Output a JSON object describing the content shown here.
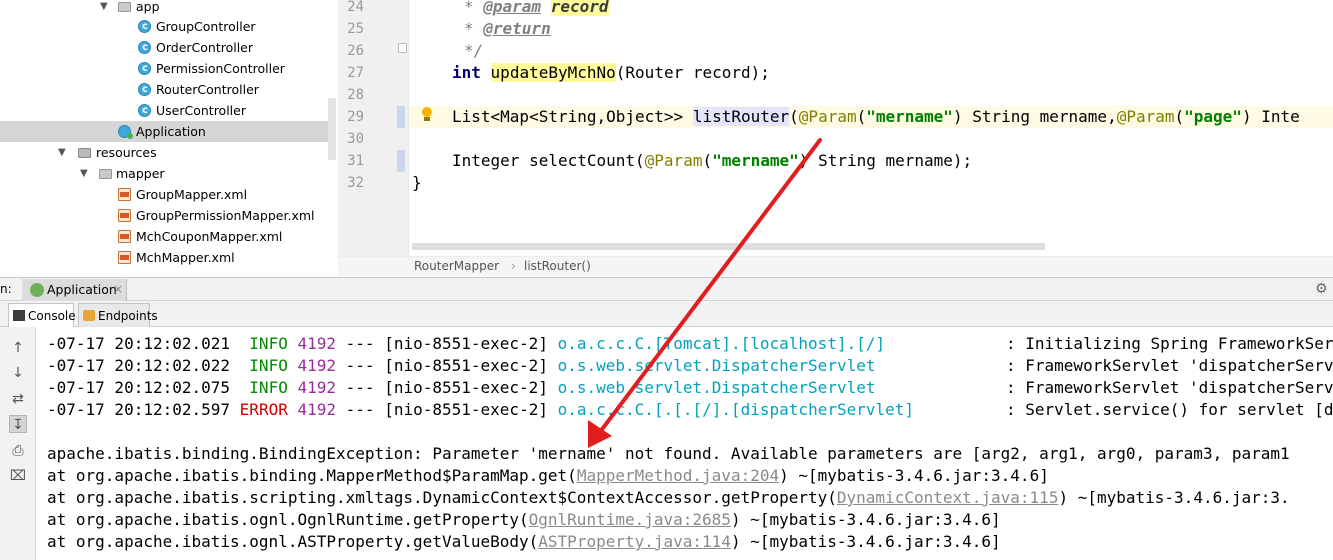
{
  "colors": {
    "arrow": "#e11d1d",
    "selection": "#d5d5d5",
    "info": "#008b00",
    "error": "#d00000",
    "link": "#8a8a8a"
  },
  "tree": {
    "items": [
      {
        "label": "app",
        "kind": "folder"
      },
      {
        "label": "GroupController",
        "kind": "class"
      },
      {
        "label": "OrderController",
        "kind": "class"
      },
      {
        "label": "PermissionController",
        "kind": "class"
      },
      {
        "label": "RouterController",
        "kind": "class"
      },
      {
        "label": "UserController",
        "kind": "class"
      },
      {
        "label": "Application",
        "kind": "app-class",
        "selected": true
      },
      {
        "label": "resources",
        "kind": "folder"
      },
      {
        "label": "mapper",
        "kind": "folder"
      },
      {
        "label": "GroupMapper.xml",
        "kind": "xml"
      },
      {
        "label": "GroupPermissionMapper.xml",
        "kind": "xml"
      },
      {
        "label": "MchCouponMapper.xml",
        "kind": "xml"
      },
      {
        "label": "MchMapper.xml",
        "kind": "xml"
      }
    ]
  },
  "editor": {
    "line_numbers": [
      "24",
      "25",
      "26",
      "27",
      "28",
      "29",
      "30",
      "31",
      "32"
    ],
    "lines": {
      "l24_star": "* ",
      "l24_tag": "@param",
      "l24_sp": " ",
      "l24_name": "record",
      "l25_star": "* ",
      "l25_tag": "@return",
      "l26": "*/",
      "l27_kw": "int",
      "l27_method": "updateByMchNo",
      "l27_rest": "(Router record);",
      "l29_a": "List<Map<String,Object>> ",
      "l29_method": "listRouter",
      "l29_b": "(",
      "l29_ann1": "@Param",
      "l29_c": "(",
      "l29_str1": "\"mername\"",
      "l29_d": ") String mername,",
      "l29_ann2": "@Param",
      "l29_e": "(",
      "l29_str2": "\"page\"",
      "l29_f": ") Inte",
      "l31_a": "Integer selectCount(",
      "l31_ann": "@Param",
      "l31_b": "(",
      "l31_str": "\"mername\"",
      "l31_c": ") String mername);",
      "l32": "}"
    },
    "breadcrumb": [
      "RouterMapper",
      "listRouter()"
    ],
    "breadcrumb_sep": "›"
  },
  "run_panel": {
    "label": "n:",
    "tab_label": "Application",
    "tab_close": "×",
    "settings_glyph": "⚙",
    "subtabs": {
      "console": "Console",
      "endpoints": "Endpoints"
    },
    "toolbar_glyphs": [
      "↑",
      "↓",
      "⇄",
      "↧",
      "⎙",
      "⌧"
    ]
  },
  "console": {
    "logs": [
      {
        "time": "-07-17 20:12:02.021",
        "level": "INFO",
        "pid": "4192",
        "dash": "---",
        "thread": "[nio-8551-exec-2]",
        "logger": "o.a.c.c.C.[Tomcat].[localhost].[/]",
        "msg": ": Initializing Spring FrameworkServ"
      },
      {
        "time": "-07-17 20:12:02.022",
        "level": "INFO",
        "pid": "4192",
        "dash": "---",
        "thread": "[nio-8551-exec-2]",
        "logger": "o.s.web.servlet.DispatcherServlet",
        "msg": ": FrameworkServlet 'dispatcherServl"
      },
      {
        "time": "-07-17 20:12:02.075",
        "level": "INFO",
        "pid": "4192",
        "dash": "---",
        "thread": "[nio-8551-exec-2]",
        "logger": "o.s.web.servlet.DispatcherServlet",
        "msg": ": FrameworkServlet 'dispatcherServl"
      },
      {
        "time": "-07-17 20:12:02.597",
        "level": "ERROR",
        "pid": "4192",
        "dash": "---",
        "thread": "[nio-8551-exec-2]",
        "logger": "o.a.c.c.C.[.[.[/].[dispatcherServlet]",
        "msg": ": Servlet.service() for servlet [di"
      }
    ],
    "exception": "apache.ibatis.binding.BindingException: Parameter 'mername' not found. Available parameters are [arg2, arg1, arg0, param3, param1",
    "stack": [
      {
        "pre": "at org.apache.ibatis.binding.MapperMethod$ParamMap.get(",
        "link": "MapperMethod.java:204",
        "post": ") ~[mybatis-3.4.6.jar:3.4.6]"
      },
      {
        "pre": "at org.apache.ibatis.scripting.xmltags.DynamicContext$ContextAccessor.getProperty(",
        "link": "DynamicContext.java:115",
        "post": ") ~[mybatis-3.4.6.jar:3."
      },
      {
        "pre": "at org.apache.ibatis.ognl.OgnlRuntime.getProperty(",
        "link": "OgnlRuntime.java:2685",
        "post": ") ~[mybatis-3.4.6.jar:3.4.6]"
      },
      {
        "pre": "at org.apache.ibatis.ognl.ASTProperty.getValueBody(",
        "link": "ASTProperty.java:114",
        "post": ") ~[mybatis-3.4.6.jar:3.4.6]"
      }
    ]
  }
}
